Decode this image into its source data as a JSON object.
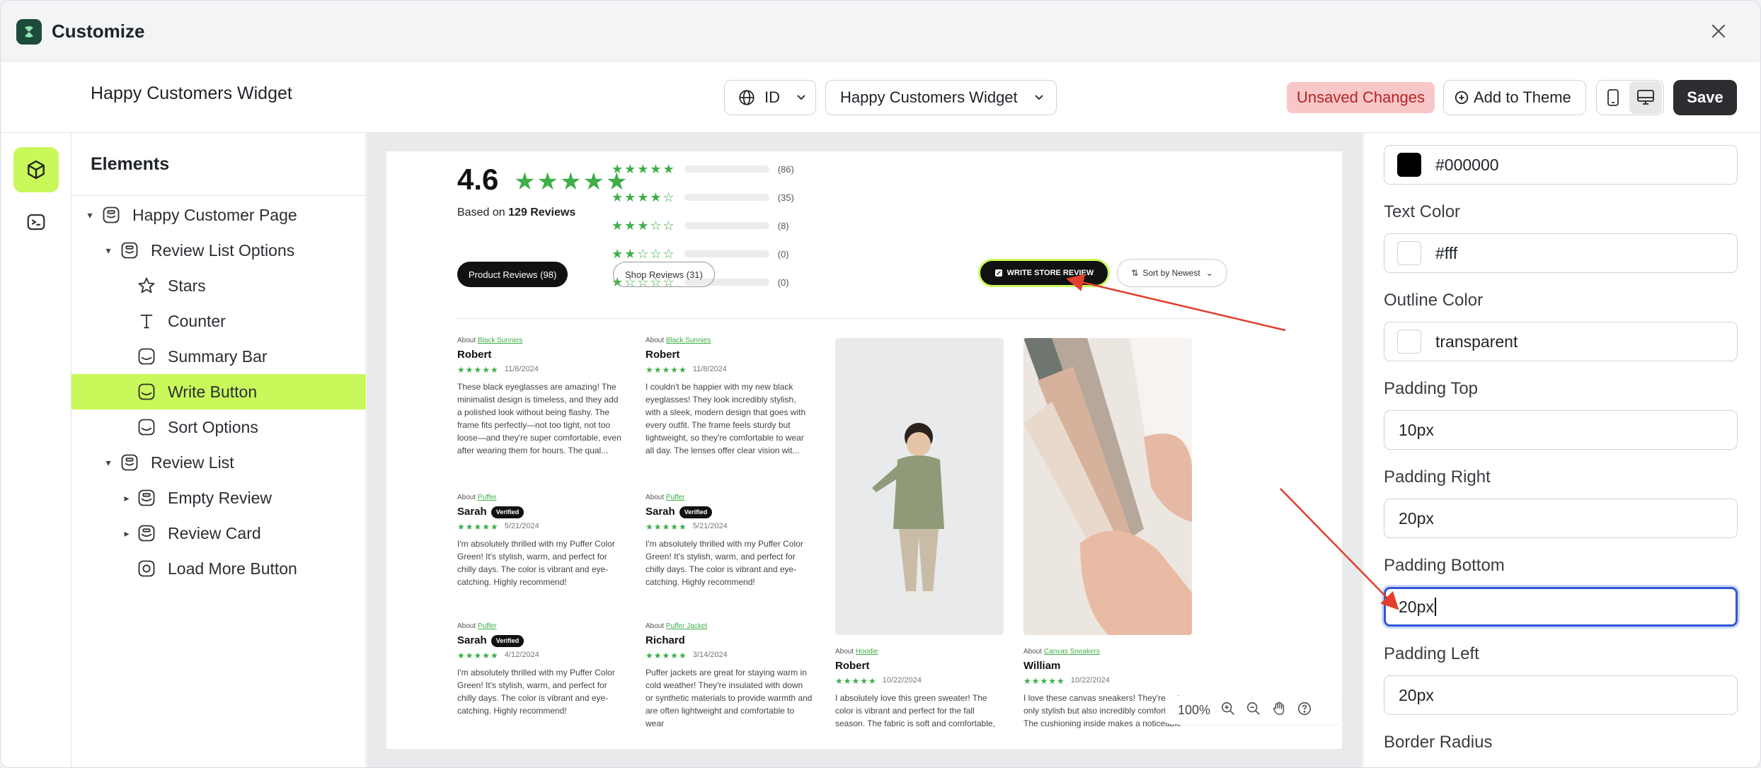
{
  "window": {
    "title": "Customize"
  },
  "toolbar": {
    "doc_title": "Happy Customers Widget",
    "language": "ID",
    "template_select": "Happy Customers Widget",
    "unsaved_label": "Unsaved Changes",
    "add_to_theme": "Add to Theme",
    "save_label": "Save"
  },
  "elements_panel": {
    "title": "Elements",
    "items": [
      {
        "label": "Happy Customer Page",
        "icon": "section-icon"
      },
      {
        "label": "Review List Options",
        "icon": "section-icon"
      },
      {
        "label": "Stars",
        "icon": "star-icon"
      },
      {
        "label": "Counter",
        "icon": "text-icon"
      },
      {
        "label": "Summary Bar",
        "icon": "block-icon"
      },
      {
        "label": "Write Button",
        "icon": "block-icon"
      },
      {
        "label": "Sort Options",
        "icon": "block-icon"
      },
      {
        "label": "Review List",
        "icon": "section-icon"
      },
      {
        "label": "Empty Review",
        "icon": "block-icon"
      },
      {
        "label": "Review Card",
        "icon": "block-icon"
      },
      {
        "label": "Load More Button",
        "icon": "widget-icon"
      }
    ]
  },
  "properties": {
    "background_value": "#000000",
    "text_color_label": "Text Color",
    "text_color_value": "#fff",
    "outline_color_label": "Outline Color",
    "outline_color_value": "transparent",
    "padding_top_label": "Padding Top",
    "padding_top_value": "10px",
    "padding_right_label": "Padding Right",
    "padding_right_value": "20px",
    "padding_bottom_label": "Padding Bottom",
    "padding_bottom_value": "20px",
    "padding_left_label": "Padding Left",
    "padding_left_value": "20px",
    "border_radius_label": "Border Radius"
  },
  "preview": {
    "rating": "4.6",
    "stars": "★★★★★",
    "based_on_prefix": "Based on",
    "based_on_count": "129 Reviews",
    "histogram": [
      {
        "stars": "★★★★★",
        "count": "(86)"
      },
      {
        "stars": "★★★★☆",
        "count": "(35)"
      },
      {
        "stars": "★★★☆☆",
        "count": "(8)"
      },
      {
        "stars": "★★☆☆☆",
        "count": "(0)"
      },
      {
        "stars": "★☆☆☆☆",
        "count": "(0)"
      }
    ],
    "tab_product": "Product Reviews (98)",
    "tab_shop": "Shop Reviews (31)",
    "write_button": "WRITE STORE REVIEW",
    "sort_button": "Sort by Newest",
    "reviews": [
      {
        "about": "About",
        "product": "Black Sunnies",
        "name": "Robert",
        "date": "11/8/2024",
        "verified": "",
        "text": "These black eyeglasses are amazing! The minimalist design is timeless, and they add a polished look without being flashy. The frame fits perfectly—not too tight, not too loose—and they're super comfortable, even after wearing them for hours. The qual..."
      },
      {
        "about": "About",
        "product": "Black Sunnies",
        "name": "Robert",
        "date": "11/8/2024",
        "verified": "",
        "text": "I couldn't be happier with my new black eyeglasses! They look incredibly stylish, with a sleek, modern design that goes with every outfit. The frame feels sturdy but lightweight, so they're comfortable to wear all day. The lenses offer clear vision wit..."
      },
      {
        "about": "About",
        "product": "Puffer",
        "name": "Sarah",
        "date": "5/21/2024",
        "verified": "Verified",
        "text": "I'm absolutely thrilled with my Puffer Color Green! It's stylish, warm, and perfect for chilly days. The color is vibrant and eye-catching. Highly recommend!"
      },
      {
        "about": "About",
        "product": "Puffer",
        "name": "Sarah",
        "date": "5/21/2024",
        "verified": "Verified",
        "text": "I'm absolutely thrilled with my Puffer Color Green! It's stylish, warm, and perfect for chilly days. The color is vibrant and eye-catching. Highly recommend!"
      },
      {
        "about": "About",
        "product": "Puffer",
        "name": "Sarah",
        "date": "4/12/2024",
        "verified": "Verified",
        "text": "I'm absolutely thrilled with my Puffer Color Green! It's stylish, warm, and perfect for chilly days. The color is vibrant and eye-catching. Highly recommend!"
      },
      {
        "about": "About",
        "product": "Puffer Jacket",
        "name": "Richard",
        "date": "3/14/2024",
        "verified": "",
        "text": "Puffer jackets are great for staying warm in cold weather! They're insulated with down or synthetic materials to provide warmth and are often lightweight and comfortable to wear"
      },
      {
        "about": "About",
        "product": "Hoodie",
        "name": "Robert",
        "date": "10/22/2024",
        "verified": "",
        "text": "I absolutely love this green sweater! The color is vibrant and perfect for the fall season. The fabric is soft and comfortable,"
      },
      {
        "about": "About",
        "product": "Canvas Sneakers",
        "name": "William",
        "date": "10/22/2024",
        "verified": "",
        "text": "I love these canvas sneakers! They're not only stylish but also incredibly comfortable. The cushioning inside makes a noticeable"
      }
    ],
    "zoom": "100%"
  },
  "colors": {
    "accent": "#c9f85a",
    "star": "#3fae49",
    "focus": "#2f56d6",
    "arrow": "#e0402c"
  }
}
